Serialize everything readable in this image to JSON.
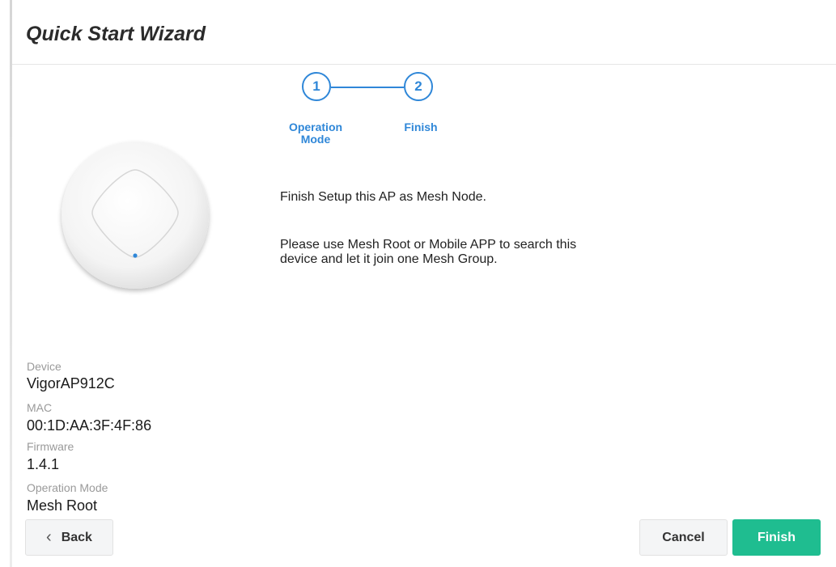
{
  "header": {
    "title": "Quick Start Wizard"
  },
  "stepper": {
    "steps": [
      {
        "number": "1",
        "label_line1": "Operation",
        "label_line2": "Mode"
      },
      {
        "number": "2",
        "label_line1": "Finish"
      }
    ],
    "color": "#2f87d8"
  },
  "message": {
    "line1": "Finish Setup this AP as Mesh Node.",
    "line2a": "Please use Mesh Root or Mobile APP to search this",
    "line2b": "device and let it join one Mesh Group."
  },
  "device_info": {
    "device_label": "Device",
    "device_value": "VigorAP912C",
    "mac_label": "MAC",
    "mac_value": "00:1D:AA:3F:4F:86",
    "firmware_label": "Firmware",
    "firmware_value": "1.4.1",
    "mode_label": "Operation Mode",
    "mode_value": "Mesh Root"
  },
  "footer": {
    "back_label": "Back",
    "cancel_label": "Cancel",
    "finish_label": "Finish",
    "finish_color": "#1fbd90"
  }
}
